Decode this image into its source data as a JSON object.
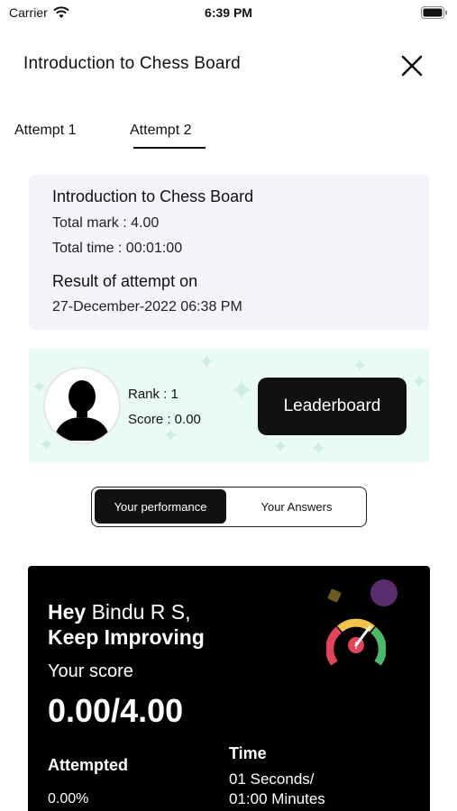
{
  "status_bar": {
    "carrier": "Carrier",
    "time": "6:39 PM"
  },
  "header": {
    "title": "Introduction to Chess Board"
  },
  "tabs": [
    {
      "label": "Attempt 1"
    },
    {
      "label": "Attempt 2"
    }
  ],
  "info": {
    "title": "Introduction to Chess Board",
    "total_mark": "Total mark : 4.00",
    "total_time": "Total time : 00:01:00",
    "result_heading": "Result of attempt on",
    "result_date": "27-December-2022 06:38 PM"
  },
  "rank_card": {
    "rank": "Rank :  1",
    "score": "Score : 0.00",
    "leaderboard_label": "Leaderboard"
  },
  "segment": {
    "active": "Your performance",
    "inactive": "Your Answers"
  },
  "performance": {
    "hey": "Hey",
    "name": "Bindu R S,",
    "keep": "Keep Improving",
    "your_score_label": "Your score",
    "score": "0.00/4.00",
    "attempted_label": "Attempted",
    "attempted_value": "0.00%",
    "time_label": "Time",
    "time_value_1": "01 Seconds/",
    "time_value_2": "01:00 Minutes"
  },
  "colors": {
    "accent": "#111111",
    "card_bg": "#f6f3fb",
    "rank_bg": "#e9fbf3"
  },
  "icons": [
    "wifi-icon",
    "battery-icon",
    "close-icon",
    "avatar-silhouette-icon",
    "gauge-icon",
    "sparkle-icon"
  ]
}
